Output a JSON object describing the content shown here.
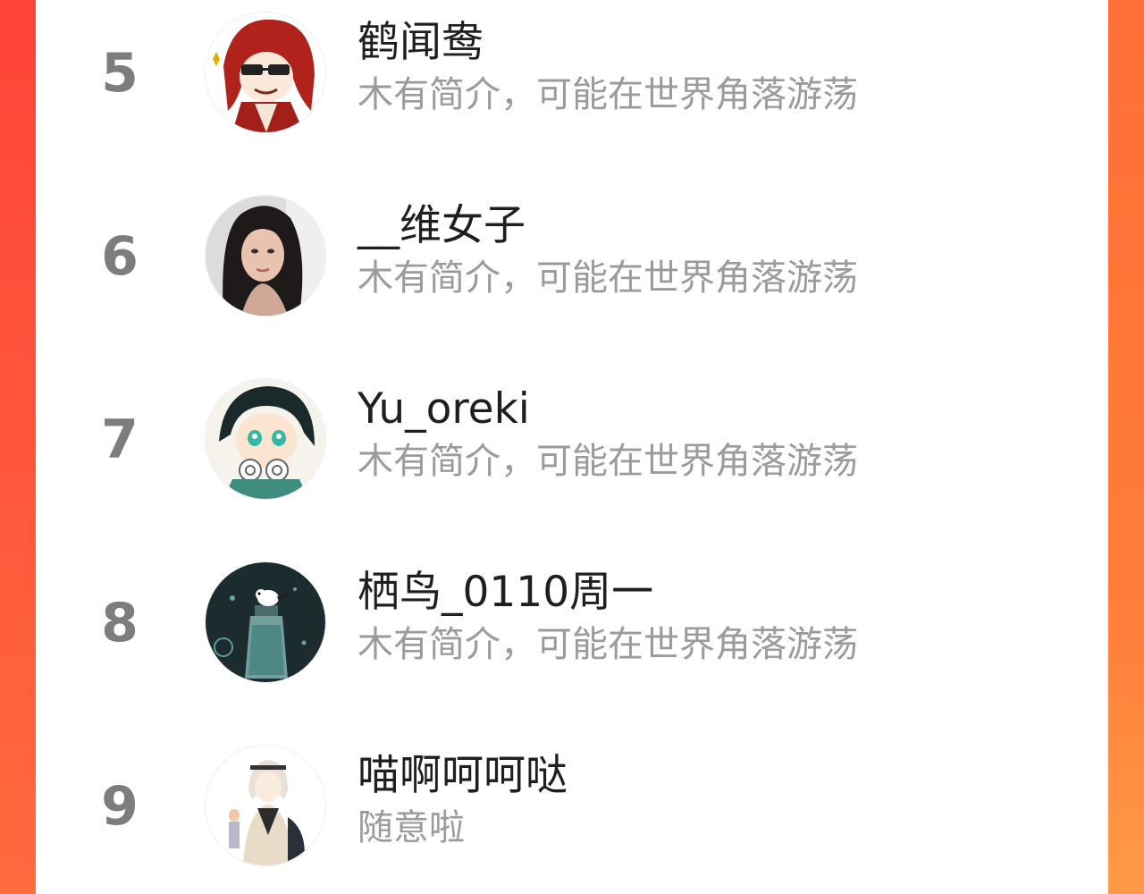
{
  "ranking": {
    "items": [
      {
        "rank": "5",
        "name": "鹤闻鸯",
        "bio": "木有简介，可能在世界角落游荡",
        "avatar_icon": "red-hair-anime-avatar-icon"
      },
      {
        "rank": "6",
        "name": "__维女子",
        "bio": "木有简介，可能在世界角落游荡",
        "avatar_icon": "woman-photo-avatar-icon"
      },
      {
        "rank": "7",
        "name": "Yu_oreki",
        "bio": "木有简介，可能在世界角落游荡",
        "avatar_icon": "green-eyed-anime-avatar-icon"
      },
      {
        "rank": "8",
        "name": "栖鸟_0110周一",
        "bio": "木有简介，可能在世界角落游荡",
        "avatar_icon": "bird-on-bottle-avatar-icon"
      },
      {
        "rank": "9",
        "name": "喵啊呵呵哒",
        "bio": "随意啦",
        "avatar_icon": "white-hair-anime-avatar-icon"
      }
    ]
  },
  "colors": {
    "edge_left": "#ff4a3c",
    "edge_right": "#ff8a3c",
    "rank_number": "#7d7d7d",
    "name_text": "#1f1f1f",
    "bio_text": "#9b9b9b"
  }
}
